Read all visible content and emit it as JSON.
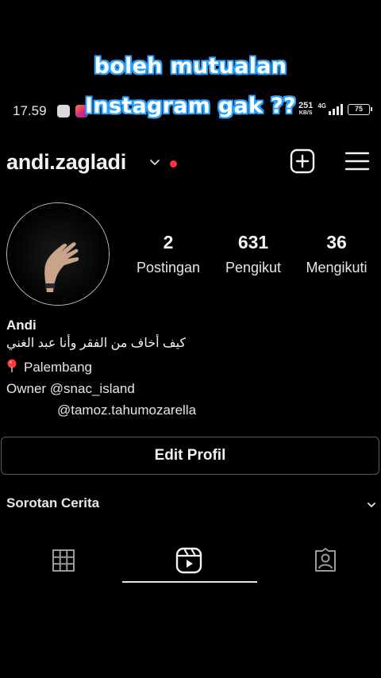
{
  "caption": {
    "line1": "boleh mutualan",
    "line2": "Instagram gak ??"
  },
  "status_bar": {
    "time": "17.59",
    "net_speed_value": "251",
    "net_speed_unit": "KB/S",
    "network_label": "4G",
    "battery": "75"
  },
  "header": {
    "username": "andi.zagladi",
    "icons": [
      "chevron-down-icon",
      "notification-dot",
      "add-post-icon",
      "menu-icon"
    ]
  },
  "stats": {
    "posts": {
      "value": "2",
      "label": "Postingan"
    },
    "followers": {
      "value": "631",
      "label": "Pengikut"
    },
    "following": {
      "value": "36",
      "label": "Mengikuti"
    }
  },
  "bio": {
    "name": "Andi",
    "arabic": "كيف أخاف من الفقر وأنا عبد الغني",
    "location": "Palembang",
    "owner_line": "Owner @snac_island",
    "second_handle": "@tamoz.tahumozarella"
  },
  "actions": {
    "edit_profile": "Edit Profil"
  },
  "highlights": {
    "label": "Sorotan Cerita"
  },
  "tabs": {
    "items": [
      "grid-icon",
      "reels-icon",
      "tagged-icon"
    ],
    "active": "reels-icon"
  },
  "colors": {
    "background": "#000000",
    "caption_outline": "#2aa0ff",
    "notification_dot": "#ff3040",
    "location_pin": "#ff3b3b"
  }
}
